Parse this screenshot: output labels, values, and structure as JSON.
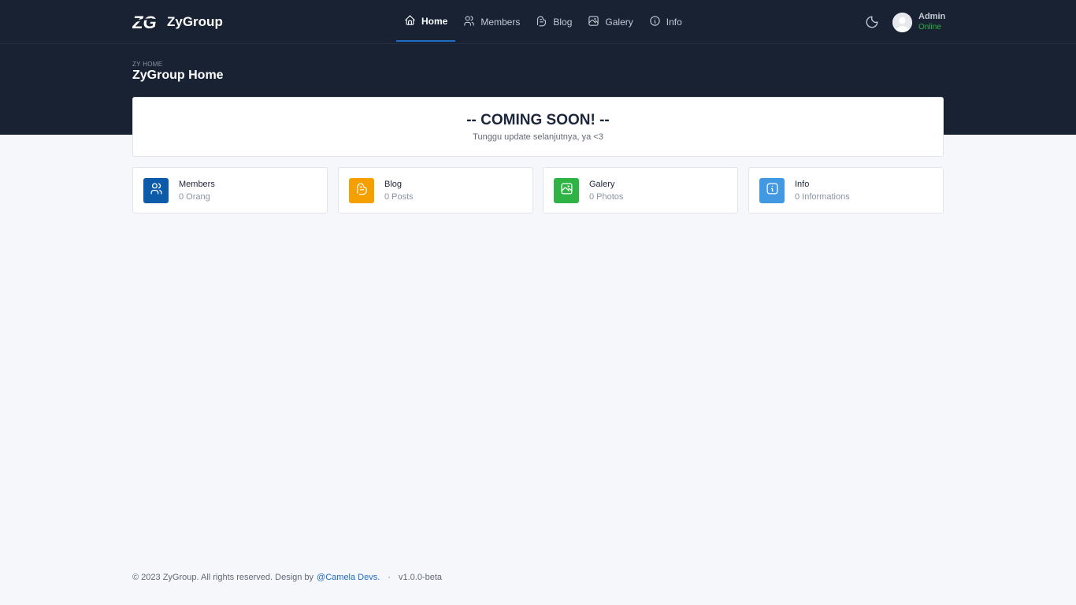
{
  "brand": {
    "name": "ZyGroup",
    "logo_text": "ZG"
  },
  "nav": {
    "items": [
      {
        "label": "Home",
        "icon": "home-icon",
        "active": true
      },
      {
        "label": "Members",
        "icon": "users-icon",
        "active": false
      },
      {
        "label": "Blog",
        "icon": "blog-icon",
        "active": false
      },
      {
        "label": "Galery",
        "icon": "photo-icon",
        "active": false
      },
      {
        "label": "Info",
        "icon": "info-icon",
        "active": false
      }
    ]
  },
  "theme_toggle": {
    "icon": "moon-icon"
  },
  "user": {
    "name": "Admin",
    "status": "Online",
    "status_color": "#2fb344"
  },
  "header": {
    "pretitle": "ZY HOME",
    "title": "ZyGroup Home"
  },
  "hero": {
    "title": "-- COMING SOON! --",
    "subtitle": "Tunggu update selanjutnya, ya <3"
  },
  "stats": [
    {
      "label": "Members",
      "value": "0 Orang",
      "icon": "users-icon",
      "color": "#0d5ba8"
    },
    {
      "label": "Blog",
      "value": "0 Posts",
      "icon": "blog-icon",
      "color": "#f59f00"
    },
    {
      "label": "Galery",
      "value": "0 Photos",
      "icon": "photo-icon",
      "color": "#2fb344"
    },
    {
      "label": "Info",
      "value": "0 Informations",
      "icon": "info-icon",
      "color": "#4299e1"
    }
  ],
  "footer": {
    "copyright": "© 2023 ZyGroup. All rights reserved. Design by",
    "designer_link": "@Camela Devs.",
    "separator": "·",
    "version": "v1.0.0-beta"
  },
  "colors": {
    "header_bg": "#182233",
    "page_bg": "#f5f7fb",
    "accent": "#206bc4"
  }
}
